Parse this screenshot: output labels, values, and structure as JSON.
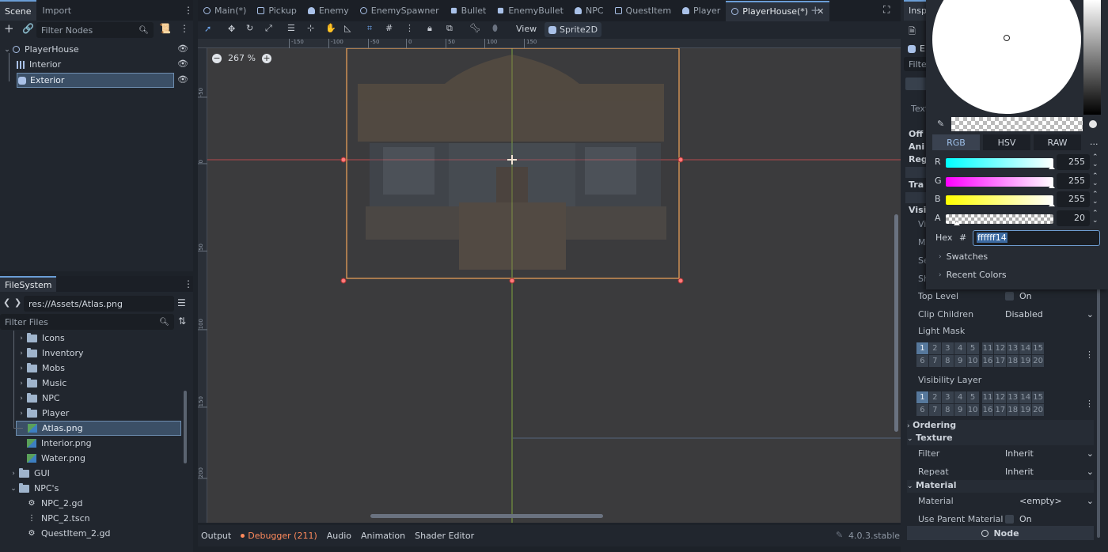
{
  "scene_dock": {
    "tabs": [
      "Scene",
      "Import"
    ],
    "filter_placeholder": "Filter Nodes",
    "nodes": [
      {
        "name": "PlayerHouse",
        "type": "node2d-icon",
        "visible": true
      },
      {
        "name": "Interior",
        "type": "tilemap-icon",
        "visible": true
      },
      {
        "name": "Exterior",
        "type": "sprite2d-icon",
        "visible": true,
        "selected": true
      }
    ]
  },
  "filesystem": {
    "title": "FileSystem",
    "path": "res://Assets/Atlas.png",
    "filter_placeholder": "Filter Files",
    "items": [
      {
        "label": "Icons",
        "kind": "folder",
        "depth": 2,
        "expanded": false
      },
      {
        "label": "Inventory",
        "kind": "folder",
        "depth": 2,
        "expanded": false
      },
      {
        "label": "Mobs",
        "kind": "folder",
        "depth": 2,
        "expanded": false
      },
      {
        "label": "Music",
        "kind": "folder",
        "depth": 2,
        "expanded": false
      },
      {
        "label": "NPC",
        "kind": "folder",
        "depth": 2,
        "expanded": false
      },
      {
        "label": "Player",
        "kind": "folder",
        "depth": 2,
        "expanded": false
      },
      {
        "label": "Atlas.png",
        "kind": "image",
        "depth": 2,
        "selected": true
      },
      {
        "label": "Interior.png",
        "kind": "image",
        "depth": 2
      },
      {
        "label": "Water.png",
        "kind": "image",
        "depth": 2
      },
      {
        "label": "GUI",
        "kind": "folder",
        "depth": 1,
        "expanded": false
      },
      {
        "label": "NPC's",
        "kind": "folder",
        "depth": 1,
        "expanded": true
      },
      {
        "label": "NPC_2.gd",
        "kind": "script",
        "depth": 2
      },
      {
        "label": "NPC_2.tscn",
        "kind": "scene",
        "depth": 2
      },
      {
        "label": "QuestItem_2.gd",
        "kind": "script",
        "depth": 2
      }
    ]
  },
  "editor_tabs": [
    {
      "label": "Main(*)",
      "icon": "node2d-icon"
    },
    {
      "label": "Pickup",
      "icon": "area2d-icon"
    },
    {
      "label": "Enemy",
      "icon": "character-icon"
    },
    {
      "label": "EnemySpawner",
      "icon": "node2d-icon"
    },
    {
      "label": "Bullet",
      "icon": "rigidbody-icon"
    },
    {
      "label": "EnemyBullet",
      "icon": "rigidbody-icon"
    },
    {
      "label": "NPC",
      "icon": "character-icon"
    },
    {
      "label": "QuestItem",
      "icon": "area2d-icon"
    },
    {
      "label": "Player",
      "icon": "character-icon"
    },
    {
      "label": "PlayerHouse(*)",
      "icon": "node2d-icon",
      "active": true
    }
  ],
  "toolbar": {
    "view_label": "View",
    "sprite_label": "Sprite2D"
  },
  "viewport": {
    "zoom": "267 %",
    "ruler_top": [
      "-150",
      "-100",
      "-50",
      "0",
      "50",
      "100",
      "150"
    ],
    "ruler_left": [
      "-50",
      "0",
      "50",
      "100",
      "150",
      "200"
    ]
  },
  "bottom_bar": {
    "tabs": [
      "Output",
      "Debugger (211)",
      "Audio",
      "Animation",
      "Shader Editor"
    ],
    "version": "4.0.3.stable"
  },
  "inspector": {
    "tab": "Insp",
    "partial_labels": [
      "E",
      "Filter",
      "Text",
      "Off",
      "Ani",
      "Reg",
      "Tra",
      "Visi",
      "Vi",
      "M",
      "Se",
      "Sh"
    ],
    "top_level": {
      "label": "Top Level",
      "value": "On"
    },
    "clip_children": {
      "label": "Clip Children",
      "value": "Disabled"
    },
    "light_mask": {
      "label": "Light Mask",
      "selected": [
        1
      ]
    },
    "visibility_layer": {
      "label": "Visibility Layer",
      "selected": [
        1
      ]
    },
    "layer_numbers_row1": [
      "1",
      "2",
      "3",
      "4",
      "5",
      "11",
      "12",
      "13",
      "14",
      "15"
    ],
    "layer_numbers_row2": [
      "6",
      "7",
      "8",
      "9",
      "10",
      "16",
      "17",
      "18",
      "19",
      "20"
    ],
    "sections": {
      "ordering": "Ordering",
      "texture": "Texture",
      "material": "Material"
    },
    "texture_filter": {
      "label": "Filter",
      "value": "Inherit"
    },
    "texture_repeat": {
      "label": "Repeat",
      "value": "Inherit"
    },
    "material": {
      "label": "Material",
      "value": "<empty>"
    },
    "use_parent_material": {
      "label": "Use Parent Material",
      "value": "On"
    },
    "node_button": "Node"
  },
  "color_picker": {
    "modes": [
      "RGB",
      "HSV",
      "RAW"
    ],
    "more": "...",
    "channels": [
      {
        "label": "R",
        "value": "255",
        "color": "#00ffff"
      },
      {
        "label": "G",
        "value": "255",
        "color": "#ff00ff"
      },
      {
        "label": "B",
        "value": "255",
        "color": "#ffff00"
      },
      {
        "label": "A",
        "value": "20",
        "color": "#ffffff"
      }
    ],
    "hex_label": "Hex",
    "hash": "#",
    "hex_value": "ffffff14",
    "swatches": "Swatches",
    "recent": "Recent Colors"
  }
}
